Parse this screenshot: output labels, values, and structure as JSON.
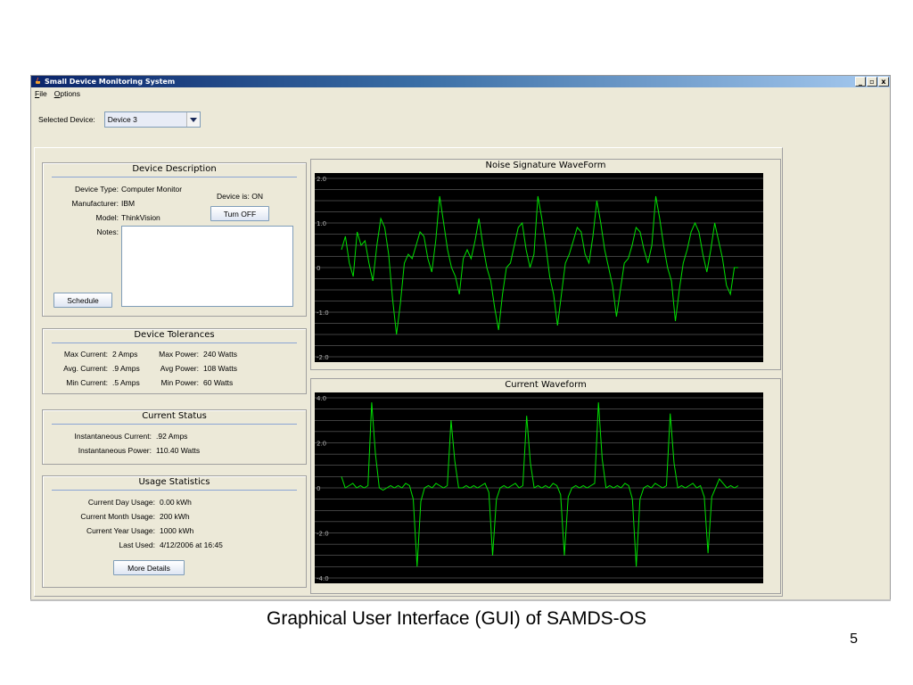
{
  "window": {
    "title": "Small Device Monitoring System",
    "controls": [
      "_",
      "▫",
      "x"
    ]
  },
  "menu": [
    "File",
    "Options"
  ],
  "device_select": {
    "label": "Selected Device:",
    "value": "Device 3"
  },
  "description": {
    "title": "Device Description",
    "labels": {
      "type": "Device Type:",
      "manufacturer": "Manufacturer:",
      "model": "Model:",
      "notes": "Notes:"
    },
    "values": {
      "type": "Computer Monitor",
      "manufacturer": "IBM",
      "model": "ThinkVision"
    },
    "status": "Device is: ON",
    "toggle_button": "Turn OFF",
    "schedule_button": "Schedule"
  },
  "tolerances": {
    "title": "Device Tolerances",
    "rows": [
      {
        "left_label": "Max Current:",
        "left_value": "2 Amps",
        "right_label": "Max Power:",
        "right_value": "240 Watts"
      },
      {
        "left_label": "Avg. Current:",
        "left_value": ".9 Amps",
        "right_label": "Avg Power:",
        "right_value": "108 Watts"
      },
      {
        "left_label": "Min Current:",
        "left_value": ".5 Amps",
        "right_label": "Min Power:",
        "right_value": "60 Watts"
      }
    ]
  },
  "current_status": {
    "title": "Current Status",
    "rows": [
      {
        "label": "Instantaneous Current:",
        "value": ".92 Amps"
      },
      {
        "label": "Instantaneous Power:",
        "value": "110.40 Watts"
      }
    ]
  },
  "usage": {
    "title": "Usage Statistics",
    "rows": [
      {
        "label": "Current Day Usage:",
        "value": "0.00 kWh"
      },
      {
        "label": "Current Month Usage:",
        "value": "200 kWh"
      },
      {
        "label": "Current Year Usage:",
        "value": "1000 kWh"
      },
      {
        "label": "Last Used:",
        "value": "4/12/2006 at 16:45"
      }
    ],
    "details_button": "More Details"
  },
  "chart_data": [
    {
      "type": "line",
      "title": "Noise Signature WaveForm",
      "ylim": [
        -2.0,
        2.0
      ],
      "yticks": [
        "2.0",
        "1.0",
        "0",
        "-1.0",
        "-2.0"
      ],
      "grid": true,
      "line_color": "#00e000",
      "background": "#000000",
      "series": [
        {
          "values": [
            0.4,
            0.7,
            0.1,
            -0.2,
            0.8,
            0.5,
            0.6,
            0.1,
            -0.3,
            0.5,
            1.1,
            0.9,
            0.3,
            -0.7,
            -1.5,
            -0.8,
            0.1,
            0.3,
            0.2,
            0.5,
            0.8,
            0.7,
            0.2,
            -0.1,
            0.6,
            1.6,
            1.0,
            0.4,
            0.0,
            -0.2,
            -0.6,
            0.2,
            0.4,
            0.2,
            0.6,
            1.1,
            0.5,
            0.0,
            -0.3,
            -0.9,
            -1.4,
            -0.6,
            0.0,
            0.1,
            0.5,
            0.9,
            1.0,
            0.4,
            0.0,
            0.3,
            1.6,
            1.1,
            0.5,
            -0.2,
            -0.6,
            -1.3,
            -0.6,
            0.1,
            0.3,
            0.6,
            0.9,
            0.8,
            0.3,
            0.1,
            0.7,
            1.5,
            1.0,
            0.4,
            0.0,
            -0.4,
            -1.1,
            -0.5,
            0.1,
            0.2,
            0.5,
            0.9,
            0.8,
            0.4,
            0.1,
            0.5,
            1.6,
            1.1,
            0.5,
            0.0,
            -0.3,
            -1.2,
            -0.5,
            0.1,
            0.4,
            0.8,
            1.0,
            0.8,
            0.3,
            -0.1,
            0.4,
            1.0,
            0.6,
            0.2,
            -0.4,
            -0.6,
            0.0,
            0.0
          ]
        }
      ]
    },
    {
      "type": "line",
      "title": "Current Waveform",
      "ylim": [
        -4.0,
        4.0
      ],
      "yticks": [
        "4.0",
        "2.0",
        "0",
        "-2.0",
        "-4.0"
      ],
      "grid": true,
      "line_color": "#00e000",
      "background": "#000000",
      "series": [
        {
          "values": [
            0.5,
            0.0,
            0.1,
            0.2,
            0.0,
            0.1,
            0.0,
            0.1,
            3.8,
            1.5,
            0.0,
            -0.1,
            0.0,
            0.1,
            0.0,
            0.1,
            0.0,
            0.2,
            0.1,
            -0.5,
            -3.5,
            -0.6,
            0.0,
            0.1,
            0.0,
            0.2,
            0.1,
            0.0,
            0.1,
            3.0,
            1.2,
            0.0,
            0.0,
            0.1,
            0.0,
            0.1,
            0.0,
            0.1,
            0.2,
            -0.2,
            -3.0,
            -0.5,
            0.0,
            0.1,
            0.0,
            0.1,
            0.2,
            0.0,
            0.1,
            3.2,
            1.1,
            0.0,
            0.1,
            0.0,
            0.1,
            0.0,
            0.2,
            0.1,
            -0.3,
            -3.0,
            -0.4,
            0.0,
            0.1,
            0.0,
            0.1,
            0.0,
            0.1,
            0.2,
            3.8,
            1.3,
            0.0,
            0.1,
            0.0,
            0.1,
            0.0,
            0.2,
            0.1,
            -0.5,
            -3.5,
            -0.5,
            0.0,
            0.1,
            0.0,
            0.2,
            0.1,
            0.0,
            0.1,
            3.3,
            1.1,
            0.0,
            0.1,
            0.0,
            0.1,
            0.2,
            0.0,
            0.1,
            -0.4,
            -2.9,
            -0.4,
            0.0,
            0.4,
            0.2,
            0.0,
            0.1,
            0.0,
            0.1
          ]
        }
      ]
    }
  ],
  "caption": "Graphical User Interface (GUI) of SAMDS-OS",
  "slide_number": "5"
}
